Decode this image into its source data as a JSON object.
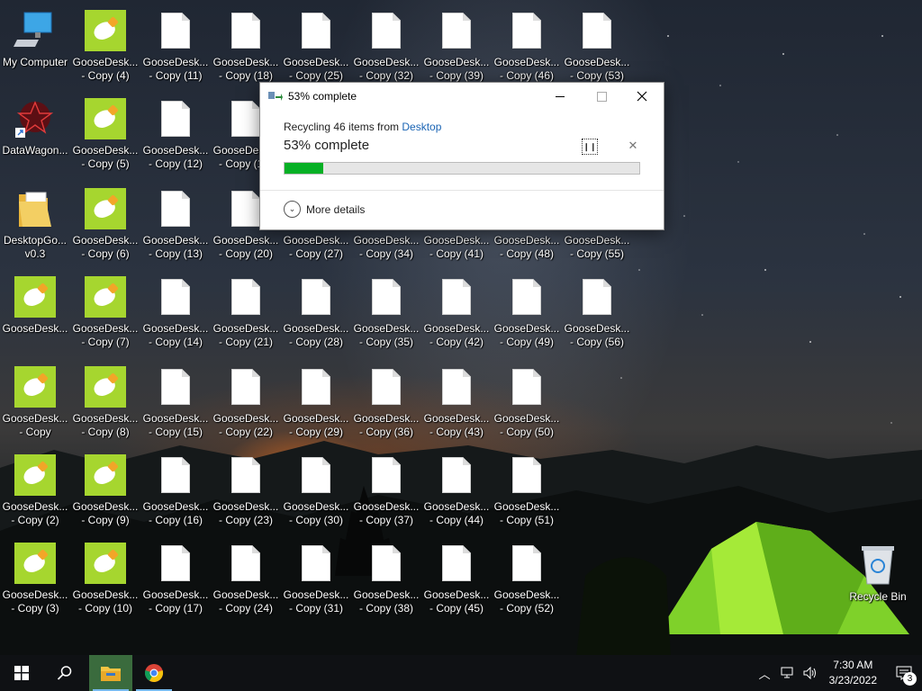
{
  "desktop": {
    "icons": [
      {
        "label": "My Computer",
        "kind": "computer"
      },
      {
        "label": "GooseDesk...\n- Copy (4)",
        "kind": "goose"
      },
      {
        "label": "GooseDesk...\n- Copy (11)",
        "kind": "doc"
      },
      {
        "label": "GooseDesk...\n- Copy (18)",
        "kind": "doc"
      },
      {
        "label": "GooseDesk...\n- Copy (25)",
        "kind": "doc"
      },
      {
        "label": "GooseDesk...\n- Copy (32)",
        "kind": "doc"
      },
      {
        "label": "GooseDesk...\n- Copy (39)",
        "kind": "doc"
      },
      {
        "label": "GooseDesk...\n- Copy (46)",
        "kind": "doc"
      },
      {
        "label": "GooseDesk...\n- Copy (53)",
        "kind": "doc"
      },
      {
        "label": "DataWagon...",
        "kind": "datawagon"
      },
      {
        "label": "GooseDesk...\n- Copy (5)",
        "kind": "goose"
      },
      {
        "label": "GooseDesk...\n- Copy (12)",
        "kind": "doc"
      },
      {
        "label": "GooseDesk...\n- Copy (19)",
        "kind": "doc"
      },
      {
        "label": "DesktopGo...\nv0.3",
        "kind": "folder"
      },
      {
        "label": "GooseDesk...\n- Copy (6)",
        "kind": "goose"
      },
      {
        "label": "GooseDesk...\n- Copy (13)",
        "kind": "doc"
      },
      {
        "label": "GooseDesk...\n- Copy (20)",
        "kind": "doc"
      },
      {
        "label": "GooseDesk...\n- Copy (27)",
        "kind": "doc"
      },
      {
        "label": "GooseDesk...\n- Copy (34)",
        "kind": "doc"
      },
      {
        "label": "GooseDesk...\n- Copy (41)",
        "kind": "doc"
      },
      {
        "label": "GooseDesk...\n- Copy (48)",
        "kind": "doc"
      },
      {
        "label": "GooseDesk...\n- Copy (55)",
        "kind": "doc"
      },
      {
        "label": "GooseDesk...",
        "kind": "goose"
      },
      {
        "label": "GooseDesk...\n- Copy (7)",
        "kind": "goose"
      },
      {
        "label": "GooseDesk...\n- Copy (14)",
        "kind": "doc"
      },
      {
        "label": "GooseDesk...\n- Copy (21)",
        "kind": "doc"
      },
      {
        "label": "GooseDesk...\n- Copy (28)",
        "kind": "doc"
      },
      {
        "label": "GooseDesk...\n- Copy (35)",
        "kind": "doc"
      },
      {
        "label": "GooseDesk...\n- Copy (42)",
        "kind": "doc"
      },
      {
        "label": "GooseDesk...\n- Copy (49)",
        "kind": "doc"
      },
      {
        "label": "GooseDesk...\n- Copy (56)",
        "kind": "doc"
      },
      {
        "label": "GooseDesk...\n- Copy",
        "kind": "goose"
      },
      {
        "label": "GooseDesk...\n- Copy (8)",
        "kind": "goose"
      },
      {
        "label": "GooseDesk...\n- Copy (15)",
        "kind": "doc"
      },
      {
        "label": "GooseDesk...\n- Copy (22)",
        "kind": "doc"
      },
      {
        "label": "GooseDesk...\n- Copy (29)",
        "kind": "doc"
      },
      {
        "label": "GooseDesk...\n- Copy (36)",
        "kind": "doc"
      },
      {
        "label": "GooseDesk...\n- Copy (43)",
        "kind": "doc"
      },
      {
        "label": "GooseDesk...\n- Copy (50)",
        "kind": "doc"
      },
      {
        "label": "GooseDesk...\n- Copy (2)",
        "kind": "goose"
      },
      {
        "label": "GooseDesk...\n- Copy (9)",
        "kind": "goose"
      },
      {
        "label": "GooseDesk...\n- Copy (16)",
        "kind": "doc"
      },
      {
        "label": "GooseDesk...\n- Copy (23)",
        "kind": "doc"
      },
      {
        "label": "GooseDesk...\n- Copy (30)",
        "kind": "doc"
      },
      {
        "label": "GooseDesk...\n- Copy (37)",
        "kind": "doc"
      },
      {
        "label": "GooseDesk...\n- Copy (44)",
        "kind": "doc"
      },
      {
        "label": "GooseDesk...\n- Copy (51)",
        "kind": "doc"
      },
      {
        "label": "GooseDesk...\n- Copy (3)",
        "kind": "goose"
      },
      {
        "label": "GooseDesk...\n- Copy (10)",
        "kind": "goose"
      },
      {
        "label": "GooseDesk...\n- Copy (17)",
        "kind": "doc"
      },
      {
        "label": "GooseDesk...\n- Copy (24)",
        "kind": "doc"
      },
      {
        "label": "GooseDesk...\n- Copy (31)",
        "kind": "doc"
      },
      {
        "label": "GooseDesk...\n- Copy (38)",
        "kind": "doc"
      },
      {
        "label": "GooseDesk...\n- Copy (45)",
        "kind": "doc"
      },
      {
        "label": "GooseDesk...\n- Copy (52)",
        "kind": "doc"
      },
      {
        "label": "Recycle Bin",
        "kind": "recyclebin"
      }
    ]
  },
  "dialog": {
    "title": "53% complete",
    "status_prefix": "Recycling 46 items from ",
    "status_link": "Desktop",
    "percent_text": "53% complete",
    "progress_fraction": 0.11,
    "pause_icon": "pause-icon",
    "cancel_icon": "close-icon",
    "more_details": "More details",
    "minimize_icon": "minimize-icon",
    "maximize_icon": "maximize-icon",
    "close_icon": "close-icon",
    "progress_color": "#06b025"
  },
  "taskbar": {
    "start_icon": "windows-logo-icon",
    "search_icon": "search-icon",
    "apps": [
      {
        "name": "file-explorer",
        "active": true
      },
      {
        "name": "chrome",
        "active": false
      }
    ],
    "tray": {
      "time": "7:30 AM",
      "date": "3/23/2022",
      "notification_count": "3"
    }
  }
}
